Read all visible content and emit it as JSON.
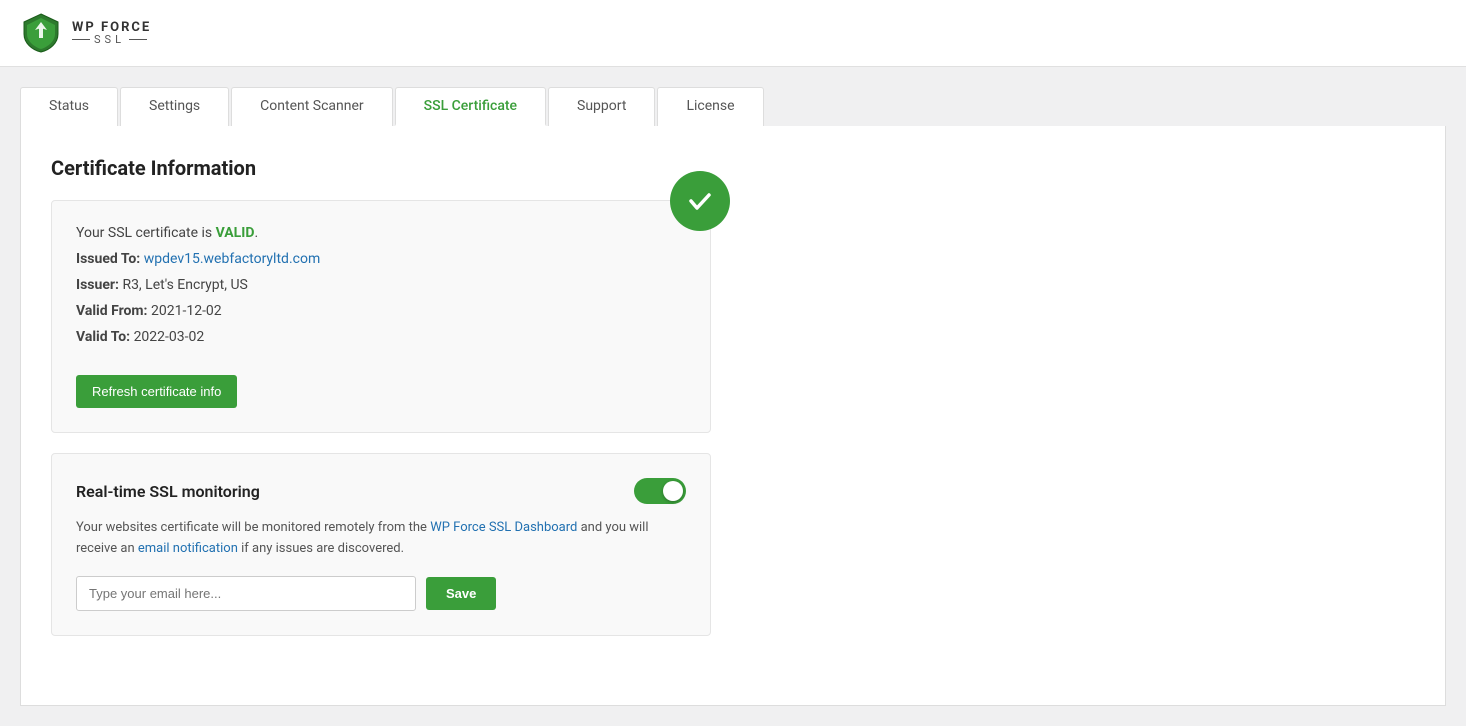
{
  "brand": {
    "name_line1": "WP FORCE",
    "name_line2": "SSL",
    "tagline": "SSL"
  },
  "tabs": [
    {
      "id": "status",
      "label": "Status",
      "active": false
    },
    {
      "id": "settings",
      "label": "Settings",
      "active": false
    },
    {
      "id": "content-scanner",
      "label": "Content Scanner",
      "active": false
    },
    {
      "id": "ssl-certificate",
      "label": "SSL Certificate",
      "active": true
    },
    {
      "id": "support",
      "label": "Support",
      "active": false
    },
    {
      "id": "license",
      "label": "License",
      "active": false
    }
  ],
  "certificate_section": {
    "title": "Certificate Information",
    "status_message_prefix": "Your SSL certificate is ",
    "status_valid": "VALID",
    "status_suffix": ".",
    "issued_to_label": "Issued To:",
    "issued_to_value": "wpdev15.webfactoryltd.com",
    "issuer_label": "Issuer:",
    "issuer_value": "R3, Let's Encrypt, US",
    "valid_from_label": "Valid From:",
    "valid_from_value": "2021-12-02",
    "valid_to_label": "Valid To:",
    "valid_to_value": "2022-03-02",
    "refresh_button_label": "Refresh certificate info"
  },
  "monitoring_section": {
    "title": "Real-time SSL monitoring",
    "toggle_on": true,
    "description_part1": "Your websites certificate will be monitored remotely from the ",
    "description_link1": "WP Force SSL Dashboard",
    "description_part2": " and you will receive an ",
    "description_link2": "email notification",
    "description_part3": " if any issues are discovered.",
    "email_placeholder": "Type your email here...",
    "save_button_label": "Save"
  },
  "colors": {
    "green": "#3a9e3a",
    "blue_link": "#2271b1",
    "valid_green": "#3a9e3a"
  }
}
